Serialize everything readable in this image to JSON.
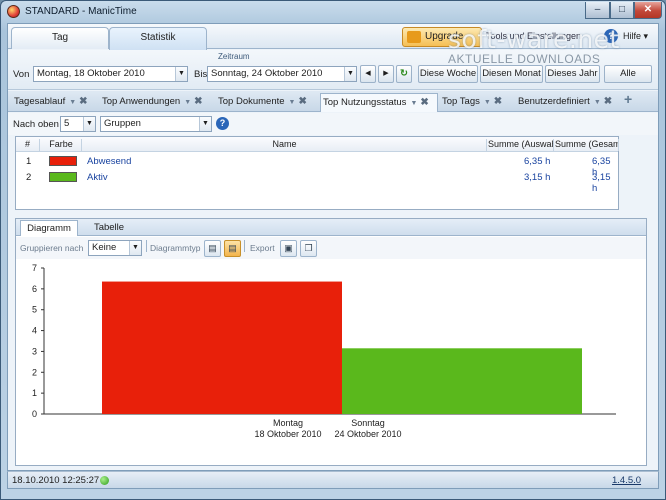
{
  "window": {
    "title": "STANDARD - ManicTime"
  },
  "main_tabs": [
    {
      "label": "Tag"
    },
    {
      "label": "Statistik"
    }
  ],
  "header": {
    "upgrade_label": "Upgrade",
    "tools_label": "Tools und Einstellungen",
    "help_label": "Hilfe",
    "watermark": "soft-ware.net",
    "watermark_sub": "AKTUELLE DOWNLOADS"
  },
  "range": {
    "section_label": "Zeitraum",
    "from_label": "Von",
    "from_value": "Montag, 18 Oktober 2010",
    "to_label": "Bis",
    "to_value": "Sonntag, 24 Oktober 2010",
    "buttons": [
      "Diese Woche",
      "Diesen Monat",
      "Dieses Jahr",
      "Alle"
    ]
  },
  "sub_tabs": [
    {
      "label": "Tagesablauf"
    },
    {
      "label": "Top Anwendungen"
    },
    {
      "label": "Top Dokumente"
    },
    {
      "label": "Top Nutzungsstatus"
    },
    {
      "label": "Top Tags"
    },
    {
      "label": "Benutzerdefiniert"
    }
  ],
  "filter": {
    "top_label": "Nach oben",
    "top_value": "5",
    "group_value": "Gruppen"
  },
  "table": {
    "columns": [
      "#",
      "Farbe",
      "Name",
      "Summe (Auswahl)",
      "Summe (Gesamt)"
    ],
    "rows": [
      {
        "num": "1",
        "color": "#e8200a",
        "name": "Abwesend",
        "sum_sel": "6,35 h",
        "sum_total": "6,35 h"
      },
      {
        "num": "2",
        "color": "#5ab81c",
        "name": "Aktiv",
        "sum_sel": "3,15 h",
        "sum_total": "3,15 h"
      }
    ]
  },
  "lower_tabs": [
    {
      "label": "Diagramm"
    },
    {
      "label": "Tabelle"
    }
  ],
  "chart_toolbar": {
    "group_label": "Gruppieren nach",
    "group_value": "Keine",
    "type_label": "Diagrammtyp",
    "export_label": "Export"
  },
  "chart_data": {
    "type": "bar",
    "categories": [
      "Montag\n18 Oktober 2010",
      "Sonntag\n24 Oktober 2010"
    ],
    "series": [
      {
        "values": [
          6.35,
          3.15
        ]
      }
    ],
    "colors": [
      "#e8200a",
      "#5ab81c"
    ],
    "ylim": [
      0,
      7
    ],
    "yticks": [
      0,
      1,
      2,
      3,
      4,
      5,
      6,
      7
    ]
  },
  "status": {
    "datetime": "18.10.2010 12:25:27",
    "version": "1.4.5.0"
  }
}
